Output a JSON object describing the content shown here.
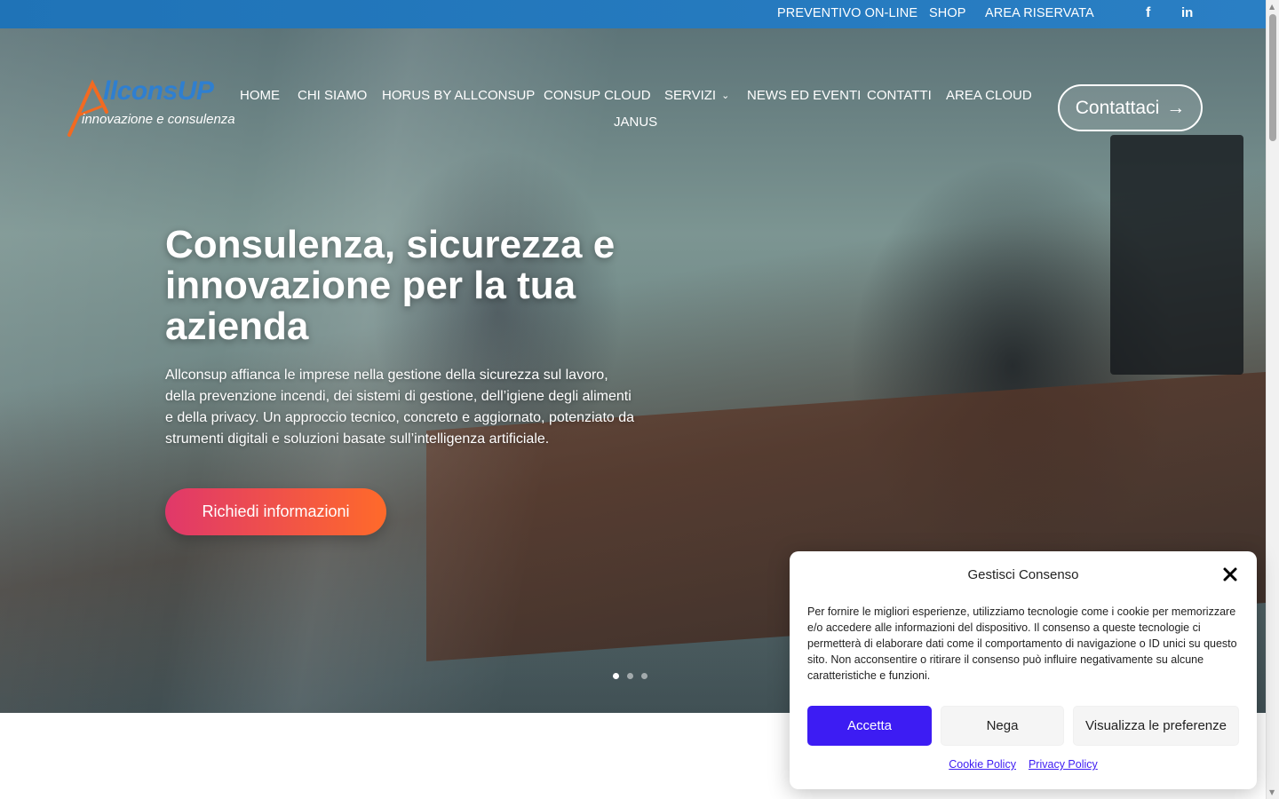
{
  "topbar": {
    "links": [
      "PREVENTIVO ON-LINE",
      "SHOP",
      "AREA RISERVATA"
    ],
    "social": [
      "facebook-icon",
      "linkedin-icon"
    ],
    "facebook_glyph": "f",
    "linkedin_glyph": "in"
  },
  "logo": {
    "name": "llconsUP",
    "tagline": "innovazione e consulenza"
  },
  "nav": {
    "items": [
      "HOME",
      "CHI SIAMO",
      "HORUS BY ALLCONSUP",
      "CONSUP CLOUD",
      "SERVIZI",
      "NEWS ED EVENTI",
      "CONTATTI",
      "AREA CLOUD",
      "JANUS"
    ],
    "contact_button": "Contattaci",
    "contact_arrow": "→"
  },
  "hero": {
    "headline": "Consulenza, sicurezza e innovazione per la tua azienda",
    "lead": "Allconsup affianca le imprese nella gestione della sicurezza sul lavoro, della prevenzione incendi, dei sistemi di gestione, dell’igiene degli alimenti e della privacy. Un approccio tecnico, concreto e aggiornato, potenziato da strumenti digitali e soluzioni basate sull’intelligenza artificiale.",
    "cta": "Richiedi informazioni",
    "slides": 3,
    "active_slide": 1
  },
  "consent": {
    "title": "Gestisci Consenso",
    "body": "Per fornire le migliori esperienze, utilizziamo tecnologie come i cookie per memorizzare e/o accedere alle informazioni del dispositivo. Il consenso a queste tecnologie ci permetterà di elaborare dati come il comportamento di navigazione o ID unici su questo sito. Non acconsentire o ritirare il consenso può influire negativamente su alcune caratteristiche e funzioni.",
    "accept": "Accetta",
    "deny": "Nega",
    "preferences": "Visualizza le preferenze",
    "cookie_policy": "Cookie Policy",
    "privacy_policy": "Privacy Policy"
  },
  "colors": {
    "topbar": "#1f73b7",
    "accent": "#3d1cf3",
    "cta_start": "#e0386a",
    "cta_end": "#ff6a2a",
    "logo_blue": "#2f7fd0",
    "logo_orange": "#f26a21"
  }
}
